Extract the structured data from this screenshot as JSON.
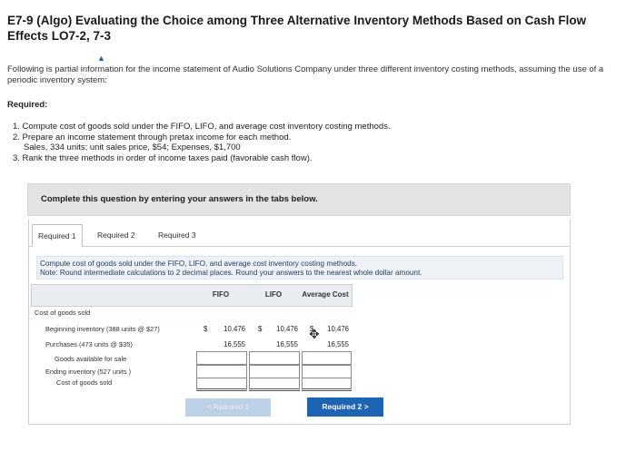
{
  "title": "E7-9 (Algo) Evaluating the Choice among Three Alternative Inventory Methods Based on Cash Flow Effects LO7-2, 7-3",
  "intro": "Following is partial information for the income statement of Audio Solutions Company under three different inventory costing methods, assuming the use of a periodic inventory system:",
  "required_heading": "Required:",
  "requirements": [
    "1. Compute cost of goods sold under the FIFO, LIFO, and average cost inventory costing methods.",
    "2. Prepare an income statement through pretax income for each method.",
    "Sales, 334 units; unit sales price, $54; Expenses, $1,700",
    "3. Rank the three methods in order of income taxes paid (favorable cash flow)."
  ],
  "banner": "Complete this question by entering your answers in the tabs below.",
  "tabs": [
    "Required 1",
    "Required 2",
    "Required 3"
  ],
  "instruction_line1": "Compute cost of goods sold under the FIFO, LIFO, and average cost inventory costing methods.",
  "instruction_line2": "Note: Round intermediate calculations to 2 decimal places. Round your answers to the nearest whole dollar amount.",
  "table": {
    "headers": [
      "FIFO",
      "LIFO",
      "Average Cost"
    ],
    "section_label": "Cost of goods sold",
    "rows": [
      {
        "label": "Beginning inventory (388 units @ $27)",
        "dollar": "$",
        "fifo": "10,476",
        "lifo": "10,476",
        "avg": "10,476"
      },
      {
        "label": "Purchases (473 units @ $35)",
        "dollar": "",
        "fifo": "16,555",
        "lifo": "16,555",
        "avg": "16,555"
      },
      {
        "label": "Goods available for sale",
        "dollar": "",
        "fifo": "",
        "lifo": "",
        "avg": ""
      },
      {
        "label": "Ending inventory (527 units )",
        "dollar": "",
        "fifo": "",
        "lifo": "",
        "avg": ""
      },
      {
        "label": "Cost of goods sold",
        "dollar": "",
        "fifo": "",
        "lifo": "",
        "avg": ""
      }
    ]
  },
  "prev_button": "< Required 1",
  "next_button": "Required 2  >"
}
